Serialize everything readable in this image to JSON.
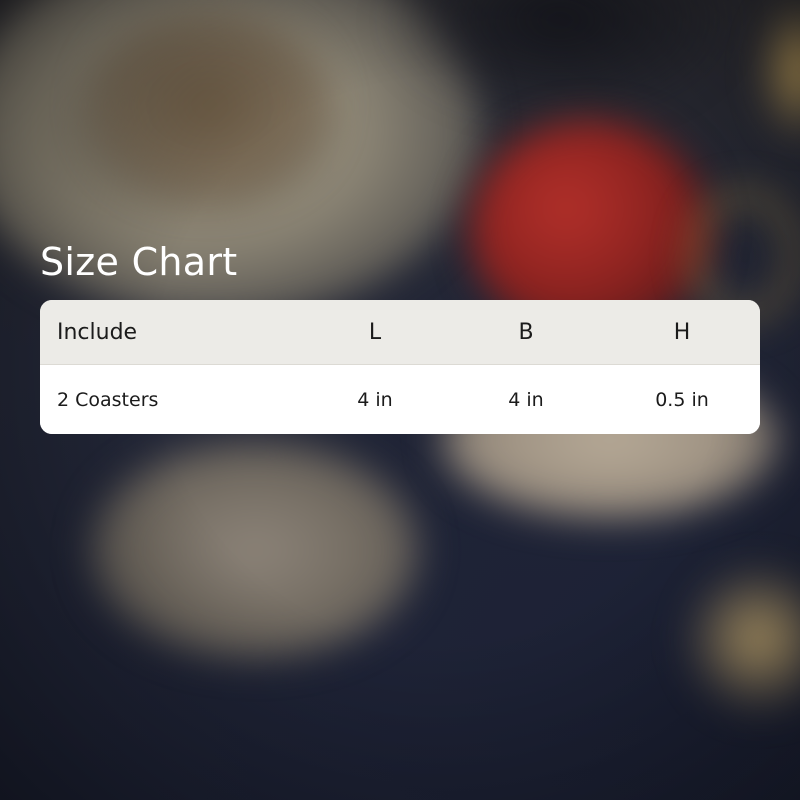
{
  "title": "Size Chart",
  "table": {
    "headers": [
      "Include",
      "L",
      "B",
      "H"
    ],
    "rows": [
      [
        "2 Coasters",
        "4 in",
        "4 in",
        "0.5 in"
      ]
    ]
  },
  "colors": {
    "table_header_bg": "#ecebe7",
    "table_body_bg": "#ffffff",
    "title_text": "#ffffff",
    "table_text": "#1b1b1b"
  }
}
